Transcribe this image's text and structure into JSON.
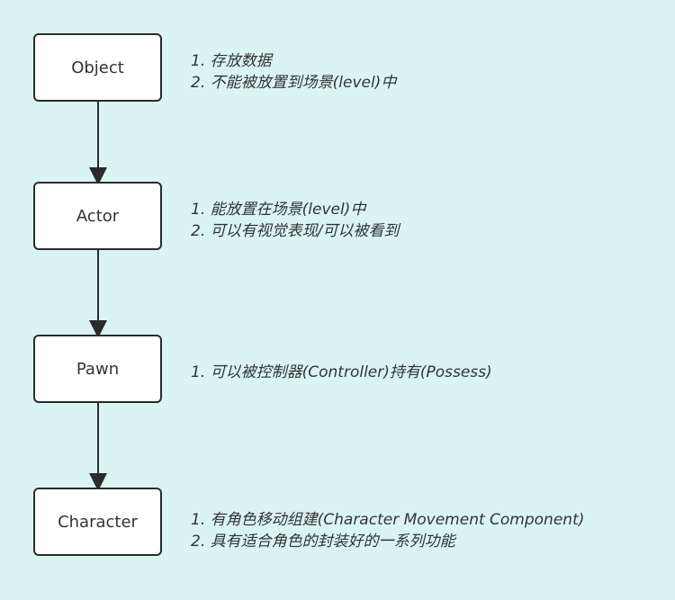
{
  "diagram": {
    "nodes": [
      {
        "label": "Object",
        "notes": [
          "1. 存放数据",
          "2. 不能被放置到场景(level)中"
        ]
      },
      {
        "label": "Actor",
        "notes": [
          "1. 能放置在场景(level)中",
          "2. 可以有视觉表现/可以被看到"
        ]
      },
      {
        "label": "Pawn",
        "notes": [
          "1. 可以被控制器(Controller)持有(Possess)"
        ]
      },
      {
        "label": "Character",
        "notes": [
          "1. 有角色移动组建(Character Movement Component)",
          "2. 具有适合角色的封装好的一系列功能"
        ]
      }
    ]
  }
}
